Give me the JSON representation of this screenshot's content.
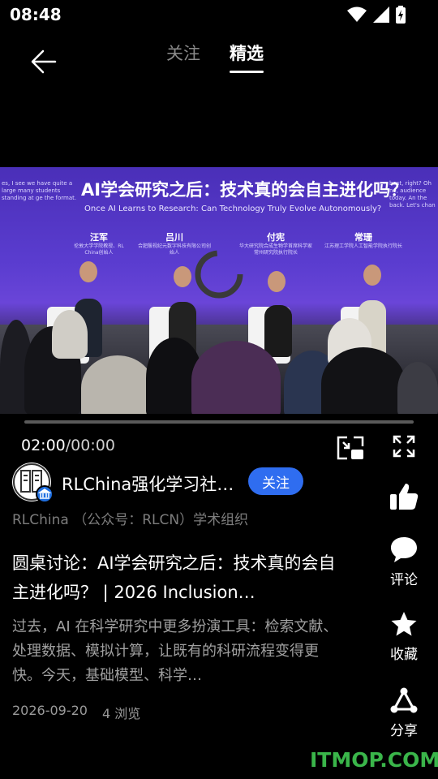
{
  "status_bar": {
    "time": "08:48"
  },
  "header": {
    "tabs": [
      {
        "label": "关注",
        "active": false
      },
      {
        "label": "精选",
        "active": true
      }
    ]
  },
  "video": {
    "slide_title": "AI学会研究之后：技术真的会自主进化吗？",
    "slide_subtitle": "Once AI Learns to Research: Can Technology Truly Evolve Autonomously?",
    "left_caption": "es, I see we have quite a large many students standing at ge the format.",
    "right_caption": "host, right? Oh no, audience today. An the back. Let's chan",
    "speakers": [
      {
        "name": "汪军",
        "role": "伦敦大学学院教授、RL China创始人"
      },
      {
        "name": "吕川",
        "role": "合肥殷视纪元数字科技有限公司创始人"
      },
      {
        "name": "付宪",
        "role": "华大研究院合成生物学首席科学家 常州研究院执行院长"
      },
      {
        "name": "常珊",
        "role": "江苏理工学院人工智能学院执行院长"
      }
    ],
    "progress": 0,
    "current_time": "02:00",
    "duration": "/00:00"
  },
  "account": {
    "name": "RLChina强化学习社…",
    "follow_label": "关注",
    "description": "RLChina （公众号：RLCN）学术组织"
  },
  "post": {
    "title": "圆桌讨论：AI学会研究之后：技术真的会自主进化吗？ | 2026 Inclusion…",
    "summary": "过去，AI 在科学研究中更多扮演工具：检索文献、处理数据、模拟计算，让既有的科研流程变得更快。今天，基础模型、科学…",
    "date": "2026-09-20",
    "views": "4 浏览"
  },
  "actions": {
    "comment": "评论",
    "favorite": "收藏",
    "share": "分享"
  },
  "watermark": "ITMOP.COM",
  "colors": {
    "accent": "#2f6df0",
    "background": "#000000",
    "watermark": "#3ab54a"
  }
}
